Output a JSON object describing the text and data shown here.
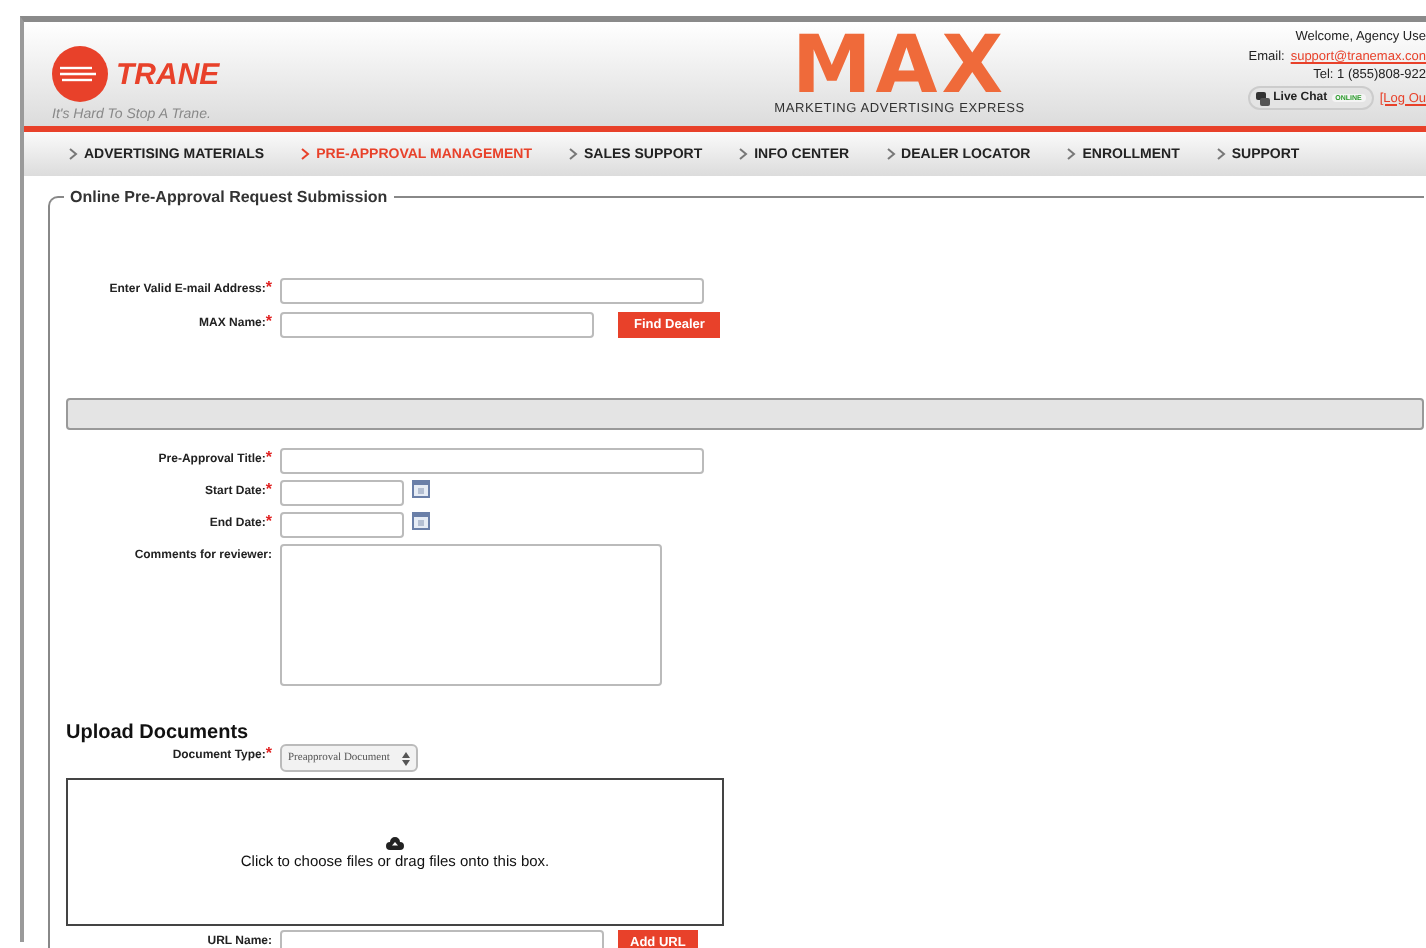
{
  "header": {
    "brand": "TRANE",
    "tagline": "It's Hard To Stop A Trane.",
    "logo": "MAX",
    "logo_subtitle": "MARKETING ADVERTISING EXPRESS",
    "account": {
      "welcome": "Welcome, Agency Use",
      "email_label": "Email:",
      "email": "support@tranemax.con",
      "phone": "Tel: 1 (855)808-922",
      "chat": "Live Chat",
      "chat_status": "ONLINE",
      "logout": "[Log Ou"
    }
  },
  "nav": [
    {
      "label": "ADVERTISING MATERIALS",
      "selected": false
    },
    {
      "label": "PRE-APPROVAL MANAGEMENT",
      "selected": true
    },
    {
      "label": "SALES SUPPORT",
      "selected": false
    },
    {
      "label": "INFO CENTER",
      "selected": false
    },
    {
      "label": "DEALER LOCATOR",
      "selected": false
    },
    {
      "label": "ENROLLMENT",
      "selected": false
    },
    {
      "label": "SUPPORT",
      "selected": false
    }
  ],
  "form": {
    "legend": "Online Pre-Approval Request Submission",
    "dealer_fields": [
      {
        "kind": "text",
        "label": "Enter Valid E-mail Address:",
        "mark": "*"
      },
      {
        "kind": "text-button",
        "label": "MAX Name:",
        "mark": "*",
        "button": "Find Dealer"
      }
    ],
    "request_fields": [
      {
        "kind": "text",
        "label": "Pre-Approval Title:",
        "mark": "*"
      },
      {
        "kind": "date",
        "label": "Start Date:",
        "mark": "*"
      },
      {
        "kind": "date",
        "label": "End Date:",
        "mark": "*"
      },
      {
        "kind": "textarea",
        "label": "Comments for reviewer:"
      }
    ],
    "upload": {
      "heading": "Upload Documents",
      "type_label": "Document Type:",
      "type_mark": "*",
      "type_value": "Preapproval Document",
      "drop_text": "Click to choose files or drag files onto this box.",
      "url_label": "URL Name:",
      "url_button": "Add URL"
    }
  }
}
